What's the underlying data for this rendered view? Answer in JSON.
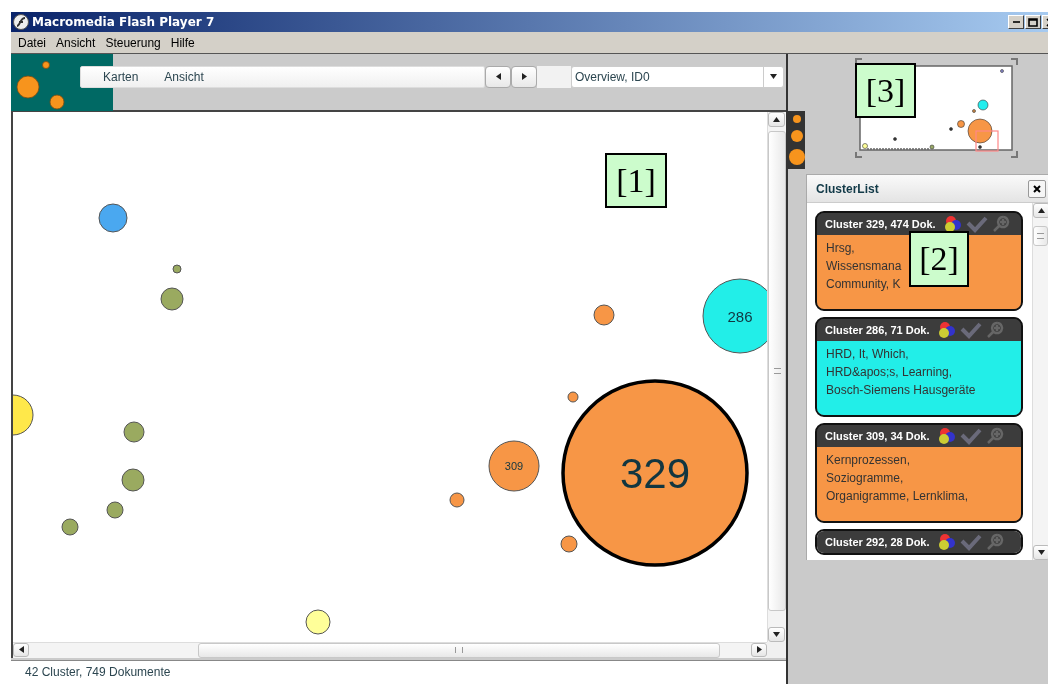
{
  "window": {
    "title": "Macromedia Flash Player 7"
  },
  "menu": [
    "Datei",
    "Ansicht",
    "Steuerung",
    "Hilfe"
  ],
  "toolbar": {
    "menus": [
      "Karten",
      "Ansicht"
    ],
    "dropdown": "Overview, ID0"
  },
  "bubbles": [
    {
      "color": "#4aa8f0",
      "selected": false
    },
    {
      "color": "#9aaa60",
      "selected": false
    },
    {
      "color": "#9aaa60",
      "selected": false
    },
    {
      "color": "#ffe84a",
      "selected": false
    },
    {
      "color": "#9aaa60",
      "selected": false
    },
    {
      "color": "#9aaa60",
      "selected": false
    },
    {
      "color": "#9aaa60",
      "selected": false
    },
    {
      "color": "#9aaa60",
      "selected": false
    },
    {
      "color": "#f79646",
      "selected": false
    },
    {
      "color": "#f79646",
      "selected": false
    },
    {
      "color": "#f79646",
      "selected": false
    },
    {
      "color": "#f79646",
      "selected": false
    },
    {
      "color": "#f79646",
      "selected": false,
      "label": "309"
    },
    {
      "color": "#f79646",
      "selected": true,
      "label": "329"
    },
    {
      "color": "#22eee8",
      "selected": false,
      "label": "286"
    },
    {
      "color": "#ffff99",
      "selected": false
    }
  ],
  "cluster_list": {
    "title": "ClusterList",
    "clusters": [
      {
        "title": "Cluster 329, 474 Dok.",
        "color": "#f79646",
        "terms": [
          "Hrsg,",
          "Wissensmana",
          "Community, K"
        ]
      },
      {
        "title": "Cluster 286, 71 Dok.",
        "color": "#22eee8",
        "terms": [
          "HRD, It, Which,",
          "HRD&apos;s, Learning,",
          "Bosch-Siemens Hausgeräte"
        ]
      },
      {
        "title": "Cluster 309, 34 Dok.",
        "color": "#f79646",
        "terms": [
          "Kernprozessen,",
          "Soziogramme,",
          "Organigramme, Lernklima,"
        ]
      },
      {
        "title": "Cluster 292, 28 Dok."
      }
    ]
  },
  "status_bar": "42 Cluster, 749 Dokumente",
  "annotations": [
    "[1]",
    "[2]",
    "[3]"
  ]
}
